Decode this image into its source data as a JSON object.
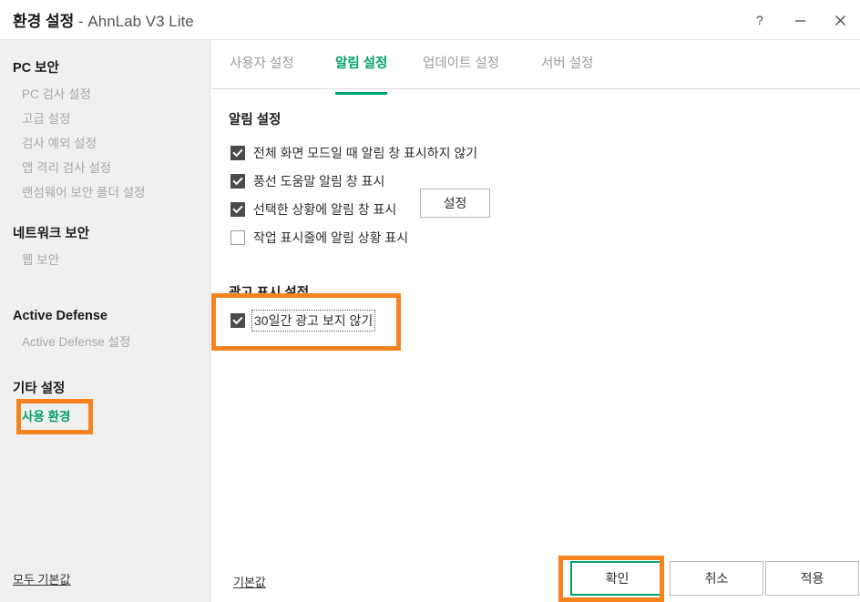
{
  "window": {
    "title_main": "환경 설정",
    "title_sub": "- AhnLab V3 Lite",
    "controls": [
      {
        "name": "help",
        "glyph": "?"
      },
      {
        "name": "minimize",
        "glyph": "—"
      },
      {
        "name": "close",
        "glyph": "✕"
      }
    ]
  },
  "sidebar": {
    "groups": [
      {
        "title": "PC 보안",
        "items": [
          {
            "label": "PC 검사 설정",
            "active": false
          },
          {
            "label": "고급 설정",
            "active": false
          },
          {
            "label": "검사 예외 설정",
            "active": false
          },
          {
            "label": "앱 격리 검사 설정",
            "active": false
          },
          {
            "label": "랜섬웨어 보안 폴더 설정",
            "active": false
          }
        ]
      },
      {
        "title": "네트워크 보안",
        "items": [
          {
            "label": "웹 보안",
            "active": false
          }
        ]
      },
      {
        "title": "Active Defense",
        "items": [
          {
            "label": "Active Defense 설정",
            "active": false
          }
        ]
      },
      {
        "title": "기타 설정",
        "items": [
          {
            "label": "사용 환경",
            "active": true
          }
        ]
      }
    ],
    "reset_all_link": "모두 기본값"
  },
  "tabs": [
    {
      "label": "사용자 설정",
      "active": false
    },
    {
      "label": "알림 설정",
      "active": true
    },
    {
      "label": "업데이트 설정",
      "active": false
    },
    {
      "label": "서버 설정",
      "active": false
    }
  ],
  "main": {
    "notify_section": {
      "title": "알림 설정",
      "options": [
        {
          "label": "전체 화면 모드일 때 알림 창 표시하지 않기",
          "checked": true,
          "focused": false
        },
        {
          "label": "풍선 도움말 알림 창 표시",
          "checked": true,
          "focused": false
        },
        {
          "label": "선택한 상황에 알림 창 표시",
          "checked": true,
          "focused": false
        },
        {
          "label": "작업 표시줄에 알림 상황 표시",
          "checked": false,
          "focused": false
        }
      ],
      "settings_button": "설정"
    },
    "ad_section": {
      "title": "광고 표시 설정",
      "options": [
        {
          "label": "30일간 광고 보지 않기",
          "checked": true,
          "focused": true
        }
      ]
    },
    "reset_link": "기본값"
  },
  "footer": {
    "buttons": [
      {
        "label": "확인",
        "primary": true
      },
      {
        "label": "취소",
        "primary": false
      },
      {
        "label": "적용",
        "primary": false
      }
    ]
  },
  "annotations": {
    "color": "#f5841f",
    "targets": [
      "사용 환경",
      "30일간 광고 보지 않기",
      "확인"
    ]
  }
}
